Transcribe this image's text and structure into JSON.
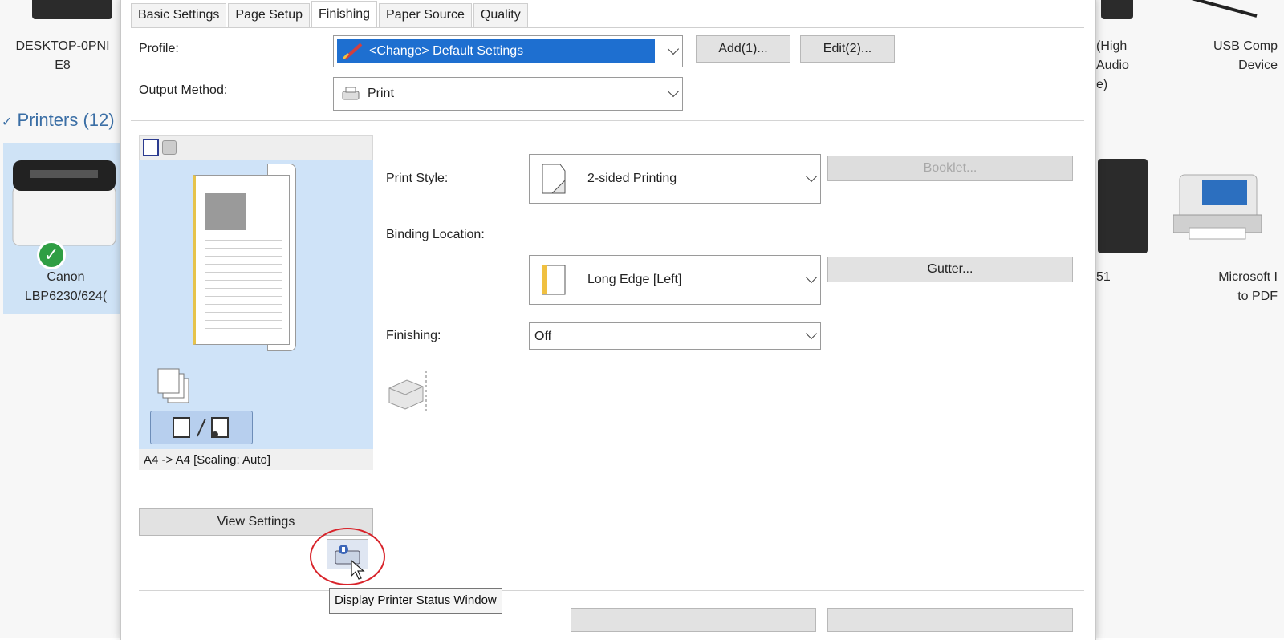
{
  "background": {
    "computer_name": [
      "DESKTOP-0PNI",
      "E8"
    ],
    "printers_header": "Printers (12)",
    "selected_printer": [
      "Canon",
      "LBP6230/624("
    ],
    "right_device_1": [
      "(High",
      "Audio",
      "e)"
    ],
    "right_device_2": [
      "USB Comp",
      "Device"
    ],
    "right_printer_partial": "51",
    "right_printer_pdf": [
      "Microsoft I",
      "to PDF"
    ]
  },
  "tabs": [
    "Basic Settings",
    "Page Setup",
    "Finishing",
    "Paper Source",
    "Quality"
  ],
  "active_tab": "Finishing",
  "profile": {
    "label": "Profile:",
    "value": "<Change> Default Settings",
    "add_button": "Add(1)...",
    "edit_button": "Edit(2)..."
  },
  "output_method": {
    "label": "Output Method:",
    "value": "Print"
  },
  "preview": {
    "status": "A4 -> A4 [Scaling: Auto]",
    "view_settings_button": "View Settings"
  },
  "finishing": {
    "print_style_label": "Print Style:",
    "print_style_value": "2-sided Printing",
    "booklet_button": "Booklet...",
    "binding_location_label": "Binding Location:",
    "binding_location_value": "Long Edge [Left]",
    "gutter_button": "Gutter...",
    "finishing_label": "Finishing:",
    "finishing_value": "Off"
  },
  "tooltip": "Display Printer Status Window",
  "colors": {
    "selection": "#1e6fd0",
    "preview_bg": "#cfe3f8",
    "annotation_circle": "#d8232a"
  }
}
